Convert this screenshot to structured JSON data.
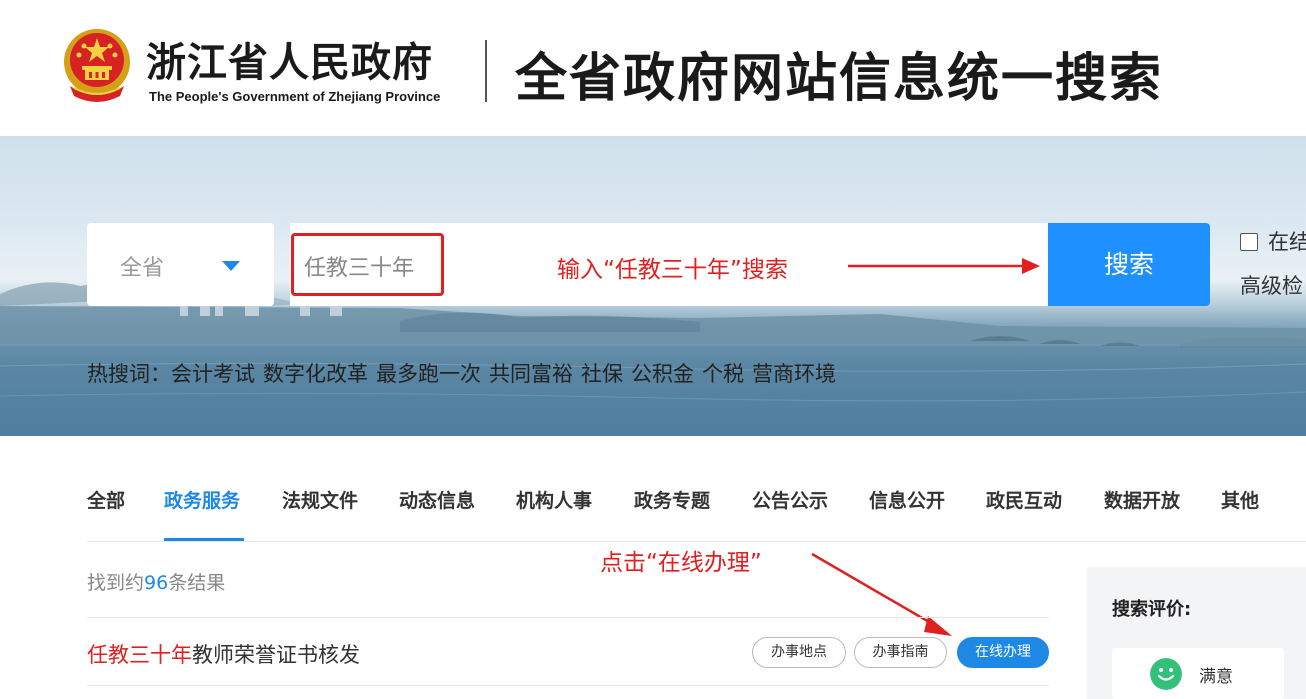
{
  "header": {
    "gov_title": "浙江省人民政府",
    "gov_subtitle": "The People's Government of Zhejiang Province",
    "site_title": "全省政府网站信息统一搜索",
    "emblem_icon": "national-emblem-icon"
  },
  "search": {
    "scope": "全省",
    "query": "任教三十年",
    "button_label": "搜索",
    "in_result_label": "在结",
    "advanced_label": "高级检"
  },
  "annotations": {
    "input_hint": "输入“任教三十年”搜索",
    "click_hint": "点击“在线办理”",
    "color": "#e02020"
  },
  "hot": {
    "label": "热搜词：",
    "words": [
      "会计考试",
      "数字化改革",
      "最多跑一次",
      "共同富裕",
      "社保",
      "公积金",
      "个税",
      "营商环境"
    ]
  },
  "tabs": [
    {
      "label": "全部",
      "active": false
    },
    {
      "label": "政务服务",
      "active": true
    },
    {
      "label": "法规文件",
      "active": false
    },
    {
      "label": "动态信息",
      "active": false
    },
    {
      "label": "机构人事",
      "active": false
    },
    {
      "label": "政务专题",
      "active": false
    },
    {
      "label": "公告公示",
      "active": false
    },
    {
      "label": "信息公开",
      "active": false
    },
    {
      "label": "政民互动",
      "active": false
    },
    {
      "label": "数据开放",
      "active": false
    },
    {
      "label": "其他",
      "active": false
    }
  ],
  "results": {
    "count_prefix": "找到约",
    "count": "96",
    "count_suffix": "条结果",
    "items": [
      {
        "title_highlight": "任教三十年",
        "title_rest": "教师荣誉证书核发",
        "actions": [
          "办事地点",
          "办事指南",
          "在线办理"
        ]
      }
    ]
  },
  "evaluation": {
    "title": "搜索评价:",
    "options": [
      {
        "label": "满意",
        "icon": "smile-icon"
      }
    ]
  },
  "colors": {
    "accent": "#1e88e5",
    "button": "#1e90ff",
    "highlight": "#e02020"
  }
}
